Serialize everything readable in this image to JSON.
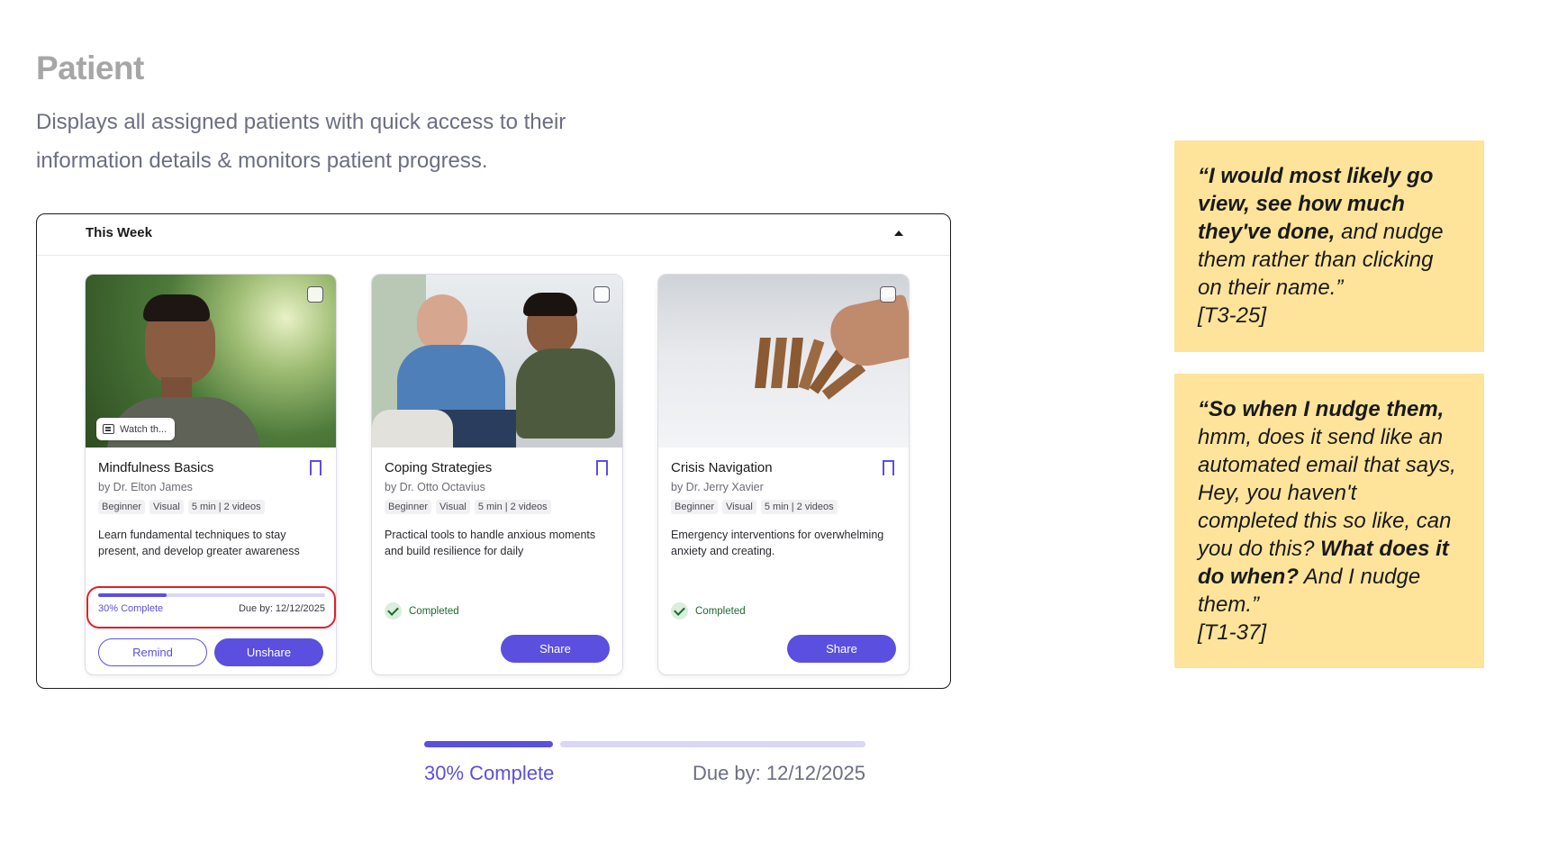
{
  "page": {
    "title": "Patient",
    "description": "Displays all assigned patients with quick access to their information details & monitors patient progress."
  },
  "panel": {
    "title": "This Week"
  },
  "cards": [
    {
      "title": "Mindfulness Basics",
      "author": "by Dr. Elton James",
      "tags": [
        "Beginner",
        "Visual",
        "5 min | 2 videos"
      ],
      "description": "Learn fundamental techniques to stay present, and develop greater awareness",
      "watch_chip": "Watch th...",
      "progress_percent": 30,
      "progress_label": "30% Complete",
      "due": "Due by: 12/12/2025",
      "remind_label": "Remind",
      "unshare_label": "Unshare"
    },
    {
      "title": "Coping Strategies",
      "author": "by Dr. Otto Octavius",
      "tags": [
        "Beginner",
        "Visual",
        "5 min | 2 videos"
      ],
      "description": "Practical tools to handle anxious moments and build resilience for daily",
      "status": "Completed",
      "share_label": "Share"
    },
    {
      "title": "Crisis Navigation",
      "author": "by Dr. Jerry Xavier",
      "tags": [
        "Beginner",
        "Visual",
        "5 min | 2 videos"
      ],
      "description": "Emergency interventions for overwhelming anxiety and creating.",
      "status": "Completed",
      "share_label": "Share"
    }
  ],
  "zoomed_progress": {
    "percent": 30,
    "label": "30% Complete",
    "due": "Due by: 12/12/2025"
  },
  "quotes": [
    {
      "bold_1": "“I would most likely go view, see how much they've done,",
      "text_1": " and nudge them rather than clicking on their name.”",
      "ref": "[T3-25]"
    },
    {
      "bold_1": "“So when I nudge them,",
      "text_1": " hmm, does it send like an automated email that says, Hey, you haven't completed this so like, can you do this? ",
      "bold_2": "What does it do when?",
      "text_2": " And I nudge them.”",
      "ref": "[T1-37]"
    }
  ],
  "colors": {
    "accent": "#5b4fe0",
    "accent_light": "#d9d6f7",
    "highlight_ring": "#e0202a",
    "quote_bg": "#fde49a",
    "completed_green": "#1b6a2b"
  }
}
